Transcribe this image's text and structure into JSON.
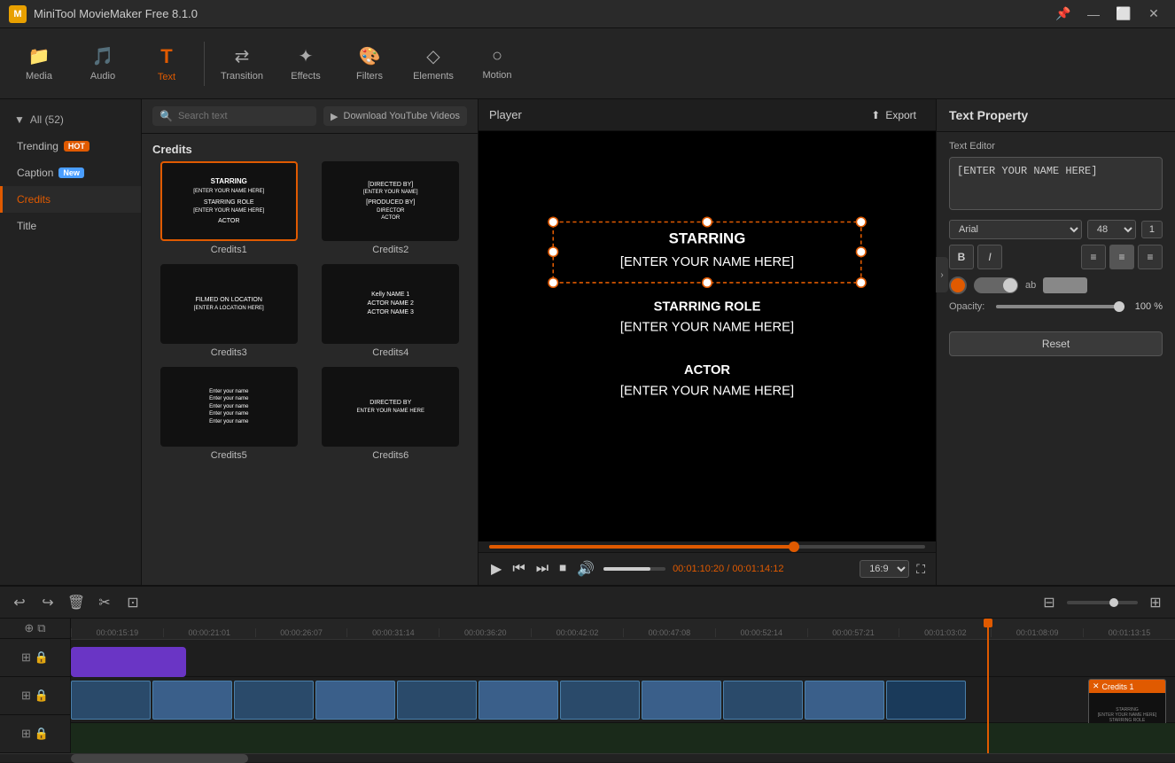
{
  "app": {
    "title": "MiniTool MovieMaker Free 8.1.0"
  },
  "titlebar": {
    "controls": [
      "pin",
      "minimize",
      "restore",
      "close"
    ]
  },
  "toolbar": {
    "items": [
      {
        "id": "media",
        "label": "Media",
        "icon": "📁"
      },
      {
        "id": "audio",
        "label": "Audio",
        "icon": "🎵"
      },
      {
        "id": "text",
        "label": "Text",
        "icon": "T",
        "active": true
      },
      {
        "id": "transition",
        "label": "Transition",
        "icon": "⇄"
      },
      {
        "id": "effects",
        "label": "Effects",
        "icon": "✦"
      },
      {
        "id": "filters",
        "label": "Filters",
        "icon": "🎨"
      },
      {
        "id": "elements",
        "label": "Elements",
        "icon": "◇"
      },
      {
        "id": "motion",
        "label": "Motion",
        "icon": "○"
      }
    ]
  },
  "left_panel": {
    "header": "All (52)",
    "items": [
      {
        "id": "trending",
        "label": "Trending",
        "badge": "HOT",
        "badge_type": "hot"
      },
      {
        "id": "caption",
        "label": "Caption",
        "badge": "New",
        "badge_type": "new"
      },
      {
        "id": "credits",
        "label": "Credits",
        "active": true
      },
      {
        "id": "title",
        "label": "Title"
      }
    ]
  },
  "center_panel": {
    "search_placeholder": "Search text",
    "download_label": "Download YouTube Videos",
    "section_title": "Credits",
    "items": [
      {
        "id": "credits1",
        "label": "Credits1",
        "selected": true,
        "lines": [
          "STARRING",
          "[ENTER YOUR NAME HERE]",
          "STARRING ROLE",
          "[ENTER YOUR NAME HERE]",
          "ACTOR"
        ]
      },
      {
        "id": "credits2",
        "label": "Credits2",
        "lines": [
          "[DIRECTED BY]",
          "[ENTER YOUR NAME]",
          "[PRODUCED BY]",
          "DIRECTOR",
          "ACTOR"
        ]
      },
      {
        "id": "credits3",
        "label": "Credits3",
        "lines": [
          "FILMED ON LOCATION",
          "[ENTER A LOCATION HERE]"
        ]
      },
      {
        "id": "credits4",
        "label": "Credits4",
        "lines": [
          "Kelly NAME 1",
          "ACTOR NAME 2",
          "ACTOR NAME 3"
        ]
      },
      {
        "id": "credits5",
        "label": "Credits5",
        "lines": [
          "Enter your name",
          "Enter your name",
          "Enter your name",
          "Enter your name",
          "Enter your name"
        ]
      },
      {
        "id": "credits6",
        "label": "Credits6",
        "lines": [
          "DIRECTED BY",
          "ENTER YOUR NAME HERE"
        ]
      }
    ]
  },
  "player": {
    "title": "Player",
    "export_label": "Export",
    "current_time": "00:01:10:20",
    "total_time": "00:01:14:12",
    "aspect_ratio": "16:9",
    "progress_percent": 70,
    "video_content": {
      "text_blocks": [
        {
          "text": "STARRING\n[ENTER YOUR NAME HERE]",
          "size": "large"
        },
        {
          "text": "STARRING ROLE\n[ENTER YOUR NAME HERE]",
          "size": "medium"
        },
        {
          "text": "ACTOR\n[ENTER YOUR NAME HERE]",
          "size": "medium"
        }
      ]
    }
  },
  "right_panel": {
    "title": "Text Property",
    "editor_label": "Text Editor",
    "text_value": "[ENTER YOUR NAME HERE]",
    "font": "Arial",
    "font_size": "48",
    "list_num": "1",
    "opacity": "100 %",
    "opacity_percent": 100,
    "reset_label": "Reset"
  },
  "timeline": {
    "toolbar_buttons": [
      "undo",
      "redo",
      "delete",
      "cut",
      "crop"
    ],
    "zoom_buttons": [
      "zoom-out",
      "zoom-in"
    ],
    "time_markers": [
      "00:00:15:19",
      "00:00:21:01",
      "00:00:26:07",
      "00:00:31:14",
      "00:00:36:20",
      "00:00:42:02",
      "00:00:47:08",
      "00:00:52:14",
      "00:00:57:21",
      "00:01:03:02",
      "00:01:08:09",
      "00:01:13:15"
    ],
    "credits_clip_label": "Credits 1"
  }
}
